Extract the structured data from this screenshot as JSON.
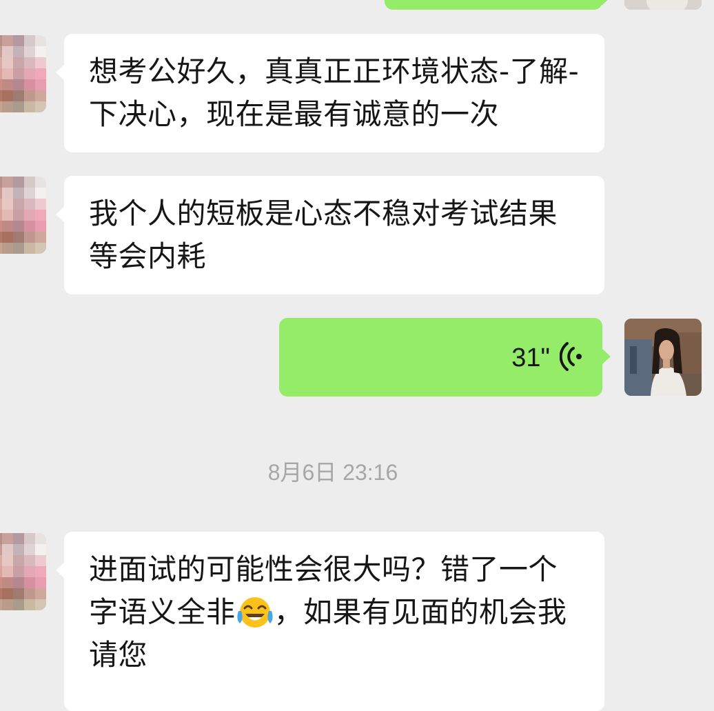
{
  "messages": [
    {
      "kind": "text",
      "side": "left",
      "text": "想考公好久，真真正正环境状态-了解-下决心，现在是最有诚意的一次"
    },
    {
      "kind": "text",
      "side": "left",
      "text": "我个人的短板是心态不稳对考试结果等会内耗"
    },
    {
      "kind": "voice",
      "side": "right",
      "duration": "31\"",
      "icon": "voice-wave-icon"
    },
    {
      "kind": "timestamp",
      "text": "8月6日 23:16"
    },
    {
      "kind": "text",
      "side": "left",
      "text_before_emoji": "进面试的可能性会很大吗？错了一个字语义全非",
      "emoji": "tears-of-joy-emoji",
      "text_after_emoji": "，如果有见面的机会我请您"
    }
  ],
  "colors": {
    "background": "#ededed",
    "incoming_bubble": "#ffffff",
    "outgoing_bubble": "#95ec69",
    "text": "#161616",
    "timestamp": "#a6a6a6"
  }
}
